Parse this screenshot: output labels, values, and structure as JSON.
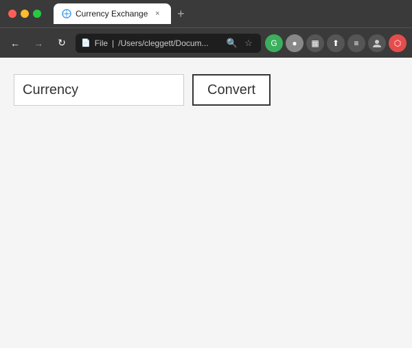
{
  "browser": {
    "title": "Currency Exchange",
    "url": "/Users/cleggett/Docum...",
    "url_prefix": "File",
    "tab_close": "×",
    "new_tab": "+"
  },
  "nav": {
    "back": "←",
    "forward": "→",
    "refresh": "↻",
    "bookmark": "☆",
    "search": "🔍"
  },
  "page": {
    "input_value": "Currency",
    "convert_label": "Convert"
  },
  "icons": {
    "g_icon": "G",
    "extensions_icon": "⊞",
    "user_icon": "👤",
    "share_icon": "⬆",
    "history_icon": "≡"
  }
}
